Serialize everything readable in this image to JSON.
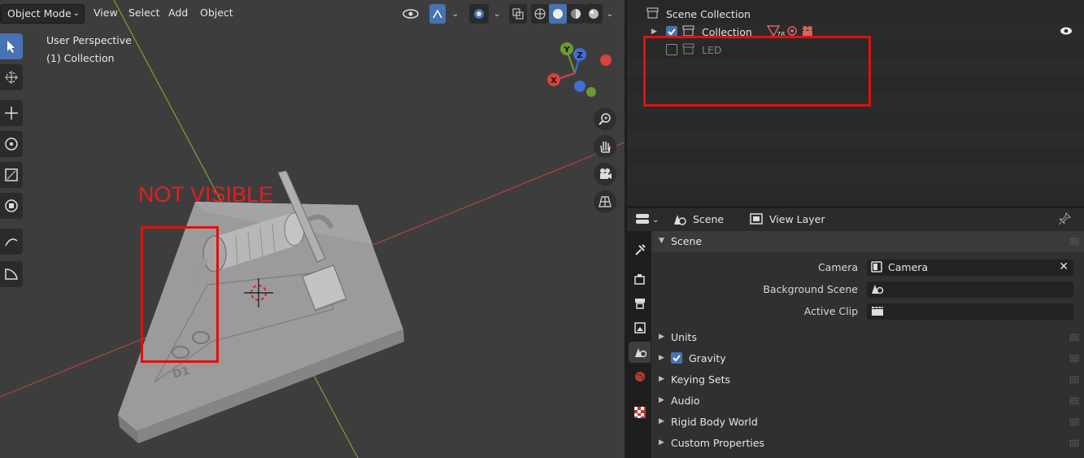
{
  "header": {
    "mode": "Object Mode",
    "menus": [
      "View",
      "Select",
      "Add",
      "Object"
    ]
  },
  "viewport": {
    "view_name": "User Perspective",
    "collection_name": "(1) Collection",
    "annotation_text": "NOT VISIBLE",
    "board_label": "D1",
    "gizmo": {
      "y": "Y",
      "z": "Z",
      "x": "X"
    },
    "colors": {
      "x_axis": "#d9423e",
      "y_axis": "#6d9a2d",
      "z_axis": "#3e6fd5",
      "annotation": "#e01010"
    }
  },
  "outliner": {
    "scene_collection": "Scene Collection",
    "collection": "Collection",
    "collection_badge": "78",
    "led": "LED"
  },
  "properties": {
    "header": {
      "scene": "Scene",
      "view_layer": "View Layer"
    },
    "scene_panel": "Scene",
    "fields": {
      "camera_label": "Camera",
      "camera_value": "Camera",
      "background_label": "Background Scene",
      "clip_label": "Active Clip"
    },
    "panels": [
      "Units",
      "Gravity",
      "Keying Sets",
      "Audio",
      "Rigid Body World",
      "Custom Properties"
    ]
  }
}
